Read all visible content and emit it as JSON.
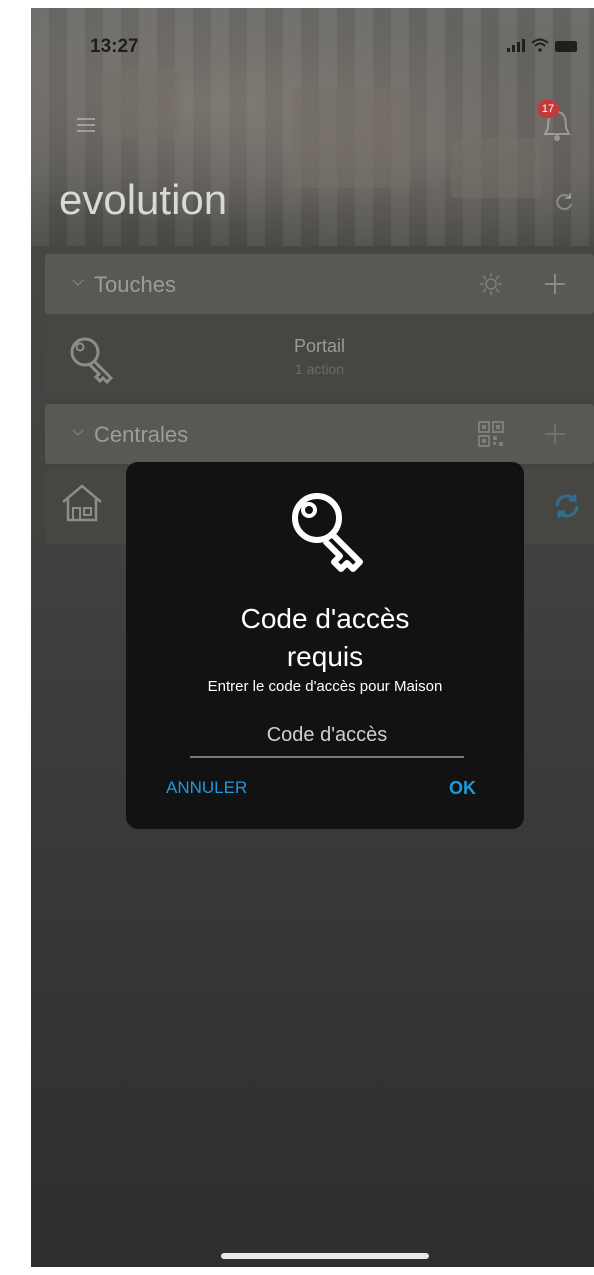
{
  "status_bar": {
    "time": "13:27"
  },
  "header": {
    "app_title": "evolution",
    "notification_count": "17"
  },
  "sections": {
    "touches": {
      "label": "Touches"
    },
    "centrales": {
      "label": "Centrales"
    }
  },
  "touches_list": [
    {
      "title": "Portail",
      "subtitle": "1 action"
    }
  ],
  "dialog": {
    "title_line1": "Code d'accès",
    "title_line2": "requis",
    "message": "Entrer le code d'accès pour Maison",
    "input_placeholder": "Code d'accès",
    "input_value": "",
    "cancel_label": "ANNULER",
    "ok_label": "OK"
  },
  "colors": {
    "accent": "#1a9be0",
    "dialog_bg": "#121212",
    "badge": "#c23a3a"
  }
}
